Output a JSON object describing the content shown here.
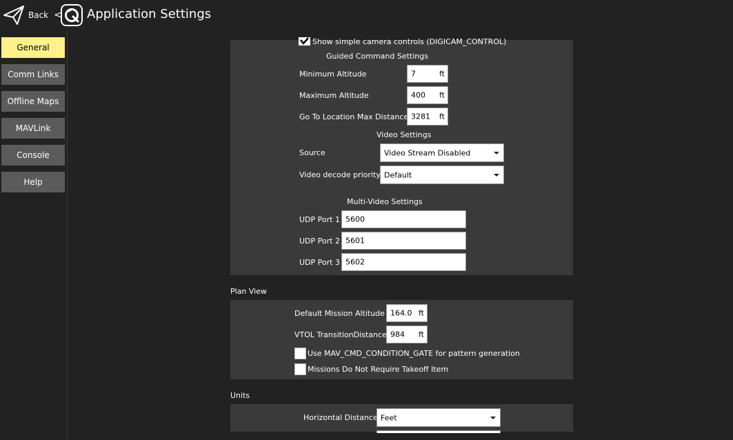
{
  "header": {
    "back_label": "Back",
    "chevron": "<",
    "title": "Application Settings",
    "back_icon": "paper-plane-icon",
    "logo_icon": "qgc-logo-icon"
  },
  "sidebar": {
    "items": [
      {
        "label": "General",
        "active": true
      },
      {
        "label": "Comm Links"
      },
      {
        "label": "Offline Maps"
      },
      {
        "label": "MAVLink"
      },
      {
        "label": "Console"
      },
      {
        "label": "Help"
      }
    ]
  },
  "camera": {
    "simple_controls_label": "Show simple camera controls (DIGICAM_CONTROL)",
    "simple_controls_checked": true
  },
  "guided": {
    "title": "Guided Command Settings",
    "min_alt_label": "Minimum Altitude",
    "min_alt_value": "7",
    "max_alt_label": "Maximum Altitude",
    "max_alt_value": "400",
    "goto_label": "Go To Location Max Distance",
    "goto_value": "3281",
    "unit": "ft"
  },
  "video": {
    "title": "Video Settings",
    "source_label": "Source",
    "source_value": "Video Stream Disabled",
    "decode_label": "Video decode priority",
    "decode_value": "Default"
  },
  "multivideo": {
    "title": "Multi-Video Settings",
    "ports": [
      {
        "label": "UDP Port 1",
        "value": "5600"
      },
      {
        "label": "UDP Port 2",
        "value": "5601"
      },
      {
        "label": "UDP Port 3",
        "value": "5602"
      }
    ]
  },
  "plan_view": {
    "title": "Plan View",
    "default_alt_label": "Default Mission Altitude",
    "default_alt_value": "164.0",
    "vtol_label": "VTOL TransitionDistance",
    "vtol_value": "984",
    "unit": "ft",
    "gate_label": "Use MAV_CMD_CONDITION_GATE for pattern generation",
    "gate_checked": false,
    "takeoff_label": "Missions Do Not Require Takeoff Item",
    "takeoff_checked": false
  },
  "units": {
    "title": "Units",
    "hdist_label": "Horizontal Distance",
    "hdist_value": "Feet"
  }
}
